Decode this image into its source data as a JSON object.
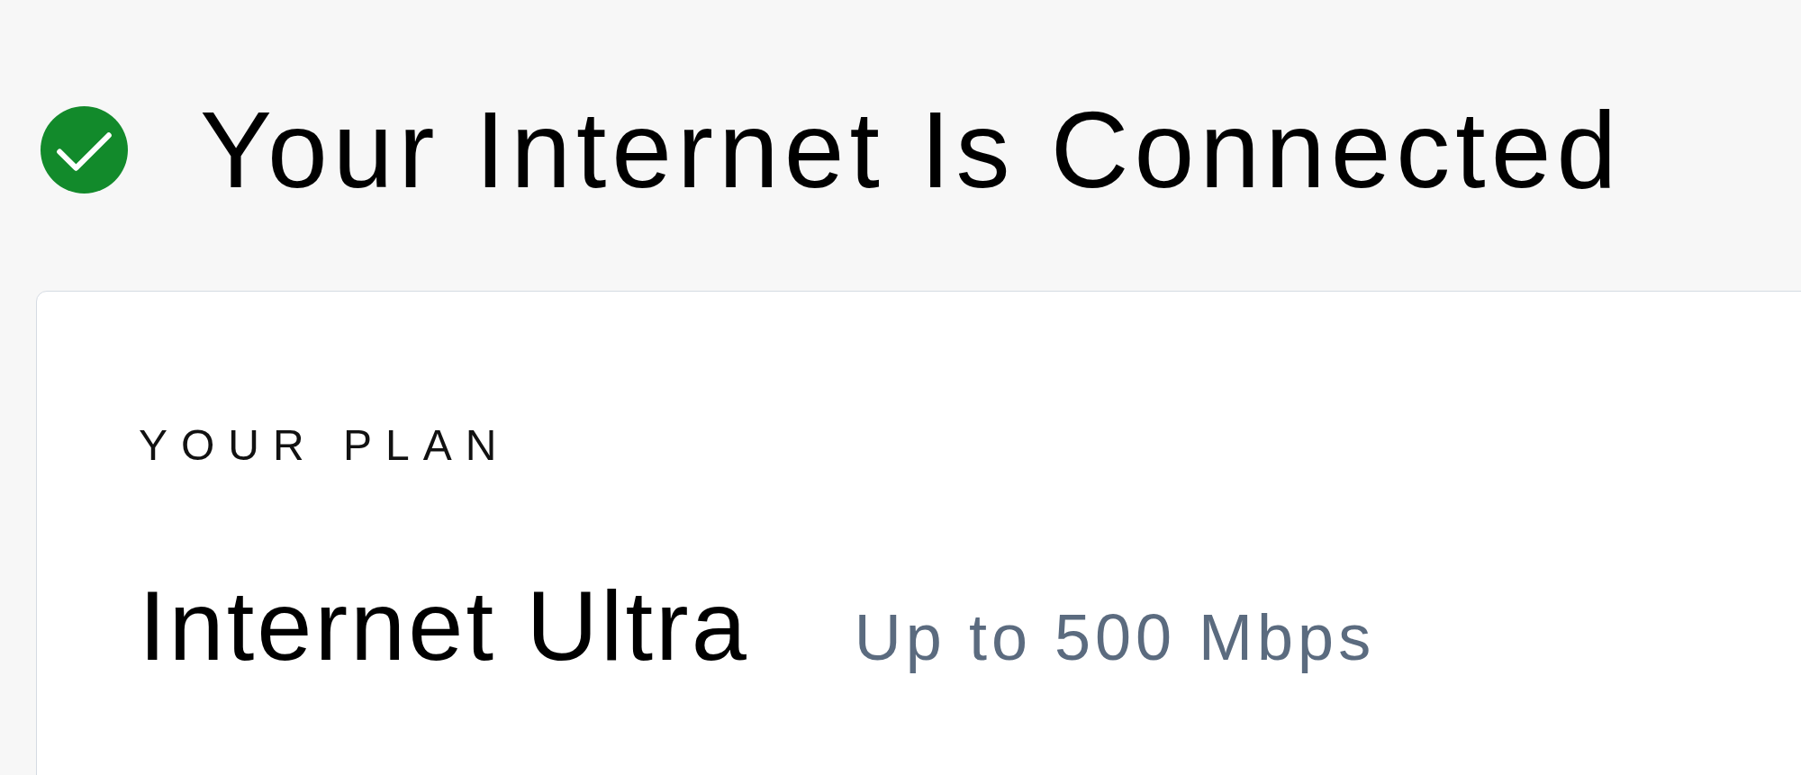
{
  "status": {
    "connected": true,
    "title": "Your Internet Is Connected"
  },
  "plan": {
    "heading": "YOUR PLAN",
    "name": "Internet Ultra",
    "speed": "Up to 500 Mbps"
  }
}
